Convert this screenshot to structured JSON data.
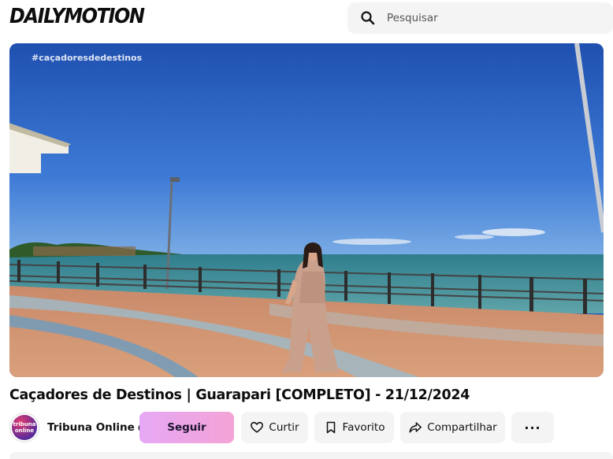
{
  "header": {
    "logo_text": "DAILYMOTION",
    "search_placeholder": "Pesquisar",
    "search_icon": "search-icon"
  },
  "player": {
    "hashtag": "#caçadoresdedestinos"
  },
  "video": {
    "title": "Caçadores de Destinos | Guarapari [COMPLETO] - 21/12/2024"
  },
  "channel": {
    "name": "Tribuna Online",
    "avatar_text_line1": "tribuna",
    "avatar_text_line2": "online",
    "verified_icon": "verified-badge-icon"
  },
  "actions": {
    "follow_label": "Seguir",
    "like_label": "Curtir",
    "favorite_label": "Favorito",
    "share_label": "Compartilhar",
    "more_label": "···"
  },
  "colors": {
    "follow_gradient_start": "#e6a8f5",
    "follow_gradient_end": "#f4a3d6",
    "button_bg": "#f4f4f4"
  }
}
